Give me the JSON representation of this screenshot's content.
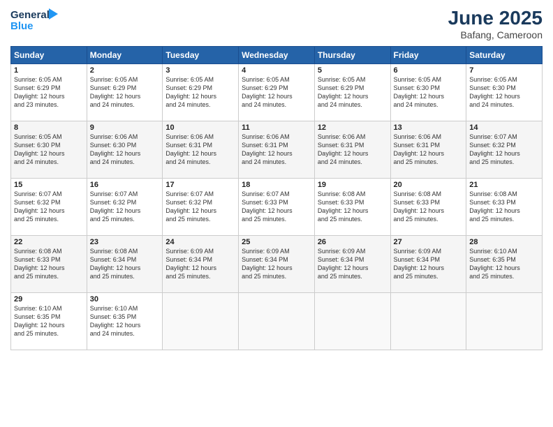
{
  "logo": {
    "line1": "General",
    "line2": "Blue"
  },
  "title": "June 2025",
  "subtitle": "Bafang, Cameroon",
  "days_header": [
    "Sunday",
    "Monday",
    "Tuesday",
    "Wednesday",
    "Thursday",
    "Friday",
    "Saturday"
  ],
  "weeks": [
    [
      {
        "day": "1",
        "sunrise": "6:05 AM",
        "sunset": "6:29 PM",
        "daylight": "12 hours and 23 minutes."
      },
      {
        "day": "2",
        "sunrise": "6:05 AM",
        "sunset": "6:29 PM",
        "daylight": "12 hours and 24 minutes."
      },
      {
        "day": "3",
        "sunrise": "6:05 AM",
        "sunset": "6:29 PM",
        "daylight": "12 hours and 24 minutes."
      },
      {
        "day": "4",
        "sunrise": "6:05 AM",
        "sunset": "6:29 PM",
        "daylight": "12 hours and 24 minutes."
      },
      {
        "day": "5",
        "sunrise": "6:05 AM",
        "sunset": "6:29 PM",
        "daylight": "12 hours and 24 minutes."
      },
      {
        "day": "6",
        "sunrise": "6:05 AM",
        "sunset": "6:30 PM",
        "daylight": "12 hours and 24 minutes."
      },
      {
        "day": "7",
        "sunrise": "6:05 AM",
        "sunset": "6:30 PM",
        "daylight": "12 hours and 24 minutes."
      }
    ],
    [
      {
        "day": "8",
        "sunrise": "6:05 AM",
        "sunset": "6:30 PM",
        "daylight": "12 hours and 24 minutes."
      },
      {
        "day": "9",
        "sunrise": "6:06 AM",
        "sunset": "6:30 PM",
        "daylight": "12 hours and 24 minutes."
      },
      {
        "day": "10",
        "sunrise": "6:06 AM",
        "sunset": "6:31 PM",
        "daylight": "12 hours and 24 minutes."
      },
      {
        "day": "11",
        "sunrise": "6:06 AM",
        "sunset": "6:31 PM",
        "daylight": "12 hours and 24 minutes."
      },
      {
        "day": "12",
        "sunrise": "6:06 AM",
        "sunset": "6:31 PM",
        "daylight": "12 hours and 24 minutes."
      },
      {
        "day": "13",
        "sunrise": "6:06 AM",
        "sunset": "6:31 PM",
        "daylight": "12 hours and 25 minutes."
      },
      {
        "day": "14",
        "sunrise": "6:07 AM",
        "sunset": "6:32 PM",
        "daylight": "12 hours and 25 minutes."
      }
    ],
    [
      {
        "day": "15",
        "sunrise": "6:07 AM",
        "sunset": "6:32 PM",
        "daylight": "12 hours and 25 minutes."
      },
      {
        "day": "16",
        "sunrise": "6:07 AM",
        "sunset": "6:32 PM",
        "daylight": "12 hours and 25 minutes."
      },
      {
        "day": "17",
        "sunrise": "6:07 AM",
        "sunset": "6:32 PM",
        "daylight": "12 hours and 25 minutes."
      },
      {
        "day": "18",
        "sunrise": "6:07 AM",
        "sunset": "6:33 PM",
        "daylight": "12 hours and 25 minutes."
      },
      {
        "day": "19",
        "sunrise": "6:08 AM",
        "sunset": "6:33 PM",
        "daylight": "12 hours and 25 minutes."
      },
      {
        "day": "20",
        "sunrise": "6:08 AM",
        "sunset": "6:33 PM",
        "daylight": "12 hours and 25 minutes."
      },
      {
        "day": "21",
        "sunrise": "6:08 AM",
        "sunset": "6:33 PM",
        "daylight": "12 hours and 25 minutes."
      }
    ],
    [
      {
        "day": "22",
        "sunrise": "6:08 AM",
        "sunset": "6:33 PM",
        "daylight": "12 hours and 25 minutes."
      },
      {
        "day": "23",
        "sunrise": "6:08 AM",
        "sunset": "6:34 PM",
        "daylight": "12 hours and 25 minutes."
      },
      {
        "day": "24",
        "sunrise": "6:09 AM",
        "sunset": "6:34 PM",
        "daylight": "12 hours and 25 minutes."
      },
      {
        "day": "25",
        "sunrise": "6:09 AM",
        "sunset": "6:34 PM",
        "daylight": "12 hours and 25 minutes."
      },
      {
        "day": "26",
        "sunrise": "6:09 AM",
        "sunset": "6:34 PM",
        "daylight": "12 hours and 25 minutes."
      },
      {
        "day": "27",
        "sunrise": "6:09 AM",
        "sunset": "6:34 PM",
        "daylight": "12 hours and 25 minutes."
      },
      {
        "day": "28",
        "sunrise": "6:10 AM",
        "sunset": "6:35 PM",
        "daylight": "12 hours and 25 minutes."
      }
    ],
    [
      {
        "day": "29",
        "sunrise": "6:10 AM",
        "sunset": "6:35 PM",
        "daylight": "12 hours and 25 minutes."
      },
      {
        "day": "30",
        "sunrise": "6:10 AM",
        "sunset": "6:35 PM",
        "daylight": "12 hours and 24 minutes."
      },
      null,
      null,
      null,
      null,
      null
    ]
  ],
  "labels": {
    "sunrise": "Sunrise:",
    "sunset": "Sunset:",
    "daylight": "Daylight:"
  }
}
